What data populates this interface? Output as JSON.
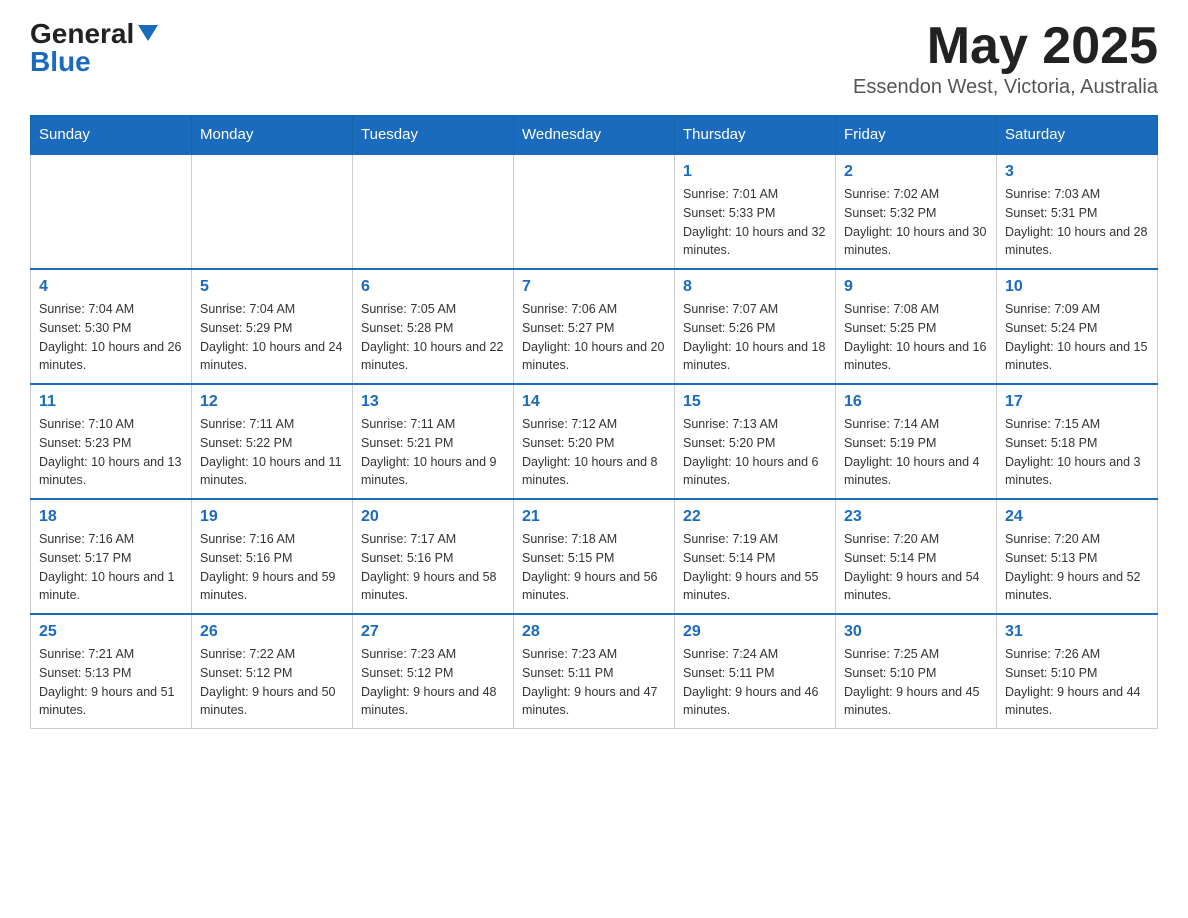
{
  "logo": {
    "general": "General",
    "blue": "Blue"
  },
  "title": "May 2025",
  "location": "Essendon West, Victoria, Australia",
  "weekdays": [
    "Sunday",
    "Monday",
    "Tuesday",
    "Wednesday",
    "Thursday",
    "Friday",
    "Saturday"
  ],
  "weeks": [
    [
      {
        "day": "",
        "info": ""
      },
      {
        "day": "",
        "info": ""
      },
      {
        "day": "",
        "info": ""
      },
      {
        "day": "",
        "info": ""
      },
      {
        "day": "1",
        "info": "Sunrise: 7:01 AM\nSunset: 5:33 PM\nDaylight: 10 hours and 32 minutes."
      },
      {
        "day": "2",
        "info": "Sunrise: 7:02 AM\nSunset: 5:32 PM\nDaylight: 10 hours and 30 minutes."
      },
      {
        "day": "3",
        "info": "Sunrise: 7:03 AM\nSunset: 5:31 PM\nDaylight: 10 hours and 28 minutes."
      }
    ],
    [
      {
        "day": "4",
        "info": "Sunrise: 7:04 AM\nSunset: 5:30 PM\nDaylight: 10 hours and 26 minutes."
      },
      {
        "day": "5",
        "info": "Sunrise: 7:04 AM\nSunset: 5:29 PM\nDaylight: 10 hours and 24 minutes."
      },
      {
        "day": "6",
        "info": "Sunrise: 7:05 AM\nSunset: 5:28 PM\nDaylight: 10 hours and 22 minutes."
      },
      {
        "day": "7",
        "info": "Sunrise: 7:06 AM\nSunset: 5:27 PM\nDaylight: 10 hours and 20 minutes."
      },
      {
        "day": "8",
        "info": "Sunrise: 7:07 AM\nSunset: 5:26 PM\nDaylight: 10 hours and 18 minutes."
      },
      {
        "day": "9",
        "info": "Sunrise: 7:08 AM\nSunset: 5:25 PM\nDaylight: 10 hours and 16 minutes."
      },
      {
        "day": "10",
        "info": "Sunrise: 7:09 AM\nSunset: 5:24 PM\nDaylight: 10 hours and 15 minutes."
      }
    ],
    [
      {
        "day": "11",
        "info": "Sunrise: 7:10 AM\nSunset: 5:23 PM\nDaylight: 10 hours and 13 minutes."
      },
      {
        "day": "12",
        "info": "Sunrise: 7:11 AM\nSunset: 5:22 PM\nDaylight: 10 hours and 11 minutes."
      },
      {
        "day": "13",
        "info": "Sunrise: 7:11 AM\nSunset: 5:21 PM\nDaylight: 10 hours and 9 minutes."
      },
      {
        "day": "14",
        "info": "Sunrise: 7:12 AM\nSunset: 5:20 PM\nDaylight: 10 hours and 8 minutes."
      },
      {
        "day": "15",
        "info": "Sunrise: 7:13 AM\nSunset: 5:20 PM\nDaylight: 10 hours and 6 minutes."
      },
      {
        "day": "16",
        "info": "Sunrise: 7:14 AM\nSunset: 5:19 PM\nDaylight: 10 hours and 4 minutes."
      },
      {
        "day": "17",
        "info": "Sunrise: 7:15 AM\nSunset: 5:18 PM\nDaylight: 10 hours and 3 minutes."
      }
    ],
    [
      {
        "day": "18",
        "info": "Sunrise: 7:16 AM\nSunset: 5:17 PM\nDaylight: 10 hours and 1 minute."
      },
      {
        "day": "19",
        "info": "Sunrise: 7:16 AM\nSunset: 5:16 PM\nDaylight: 9 hours and 59 minutes."
      },
      {
        "day": "20",
        "info": "Sunrise: 7:17 AM\nSunset: 5:16 PM\nDaylight: 9 hours and 58 minutes."
      },
      {
        "day": "21",
        "info": "Sunrise: 7:18 AM\nSunset: 5:15 PM\nDaylight: 9 hours and 56 minutes."
      },
      {
        "day": "22",
        "info": "Sunrise: 7:19 AM\nSunset: 5:14 PM\nDaylight: 9 hours and 55 minutes."
      },
      {
        "day": "23",
        "info": "Sunrise: 7:20 AM\nSunset: 5:14 PM\nDaylight: 9 hours and 54 minutes."
      },
      {
        "day": "24",
        "info": "Sunrise: 7:20 AM\nSunset: 5:13 PM\nDaylight: 9 hours and 52 minutes."
      }
    ],
    [
      {
        "day": "25",
        "info": "Sunrise: 7:21 AM\nSunset: 5:13 PM\nDaylight: 9 hours and 51 minutes."
      },
      {
        "day": "26",
        "info": "Sunrise: 7:22 AM\nSunset: 5:12 PM\nDaylight: 9 hours and 50 minutes."
      },
      {
        "day": "27",
        "info": "Sunrise: 7:23 AM\nSunset: 5:12 PM\nDaylight: 9 hours and 48 minutes."
      },
      {
        "day": "28",
        "info": "Sunrise: 7:23 AM\nSunset: 5:11 PM\nDaylight: 9 hours and 47 minutes."
      },
      {
        "day": "29",
        "info": "Sunrise: 7:24 AM\nSunset: 5:11 PM\nDaylight: 9 hours and 46 minutes."
      },
      {
        "day": "30",
        "info": "Sunrise: 7:25 AM\nSunset: 5:10 PM\nDaylight: 9 hours and 45 minutes."
      },
      {
        "day": "31",
        "info": "Sunrise: 7:26 AM\nSunset: 5:10 PM\nDaylight: 9 hours and 44 minutes."
      }
    ]
  ]
}
